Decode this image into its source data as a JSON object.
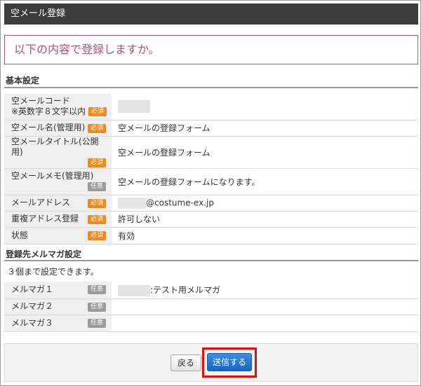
{
  "window_title": "空メール登録",
  "confirm_message": "以下の内容で登録しますか。",
  "basic": {
    "heading": "基本設定",
    "rows": [
      {
        "label": "空メールコード",
        "sub": "※英数字８文字以内",
        "badge": "必須",
        "value": ""
      },
      {
        "label": "空メール名(管理用)",
        "badge": "必須",
        "value": "空メールの登録フォーム"
      },
      {
        "label": "空メールタイトル(公開用)",
        "badge": "必須",
        "value": "空メールの登録フォーム"
      },
      {
        "label": "空メールメモ(管理用)",
        "badge": "任意",
        "value": "空メールの登録フォームになります。"
      },
      {
        "label": "メールアドレス",
        "badge": "必須",
        "value": "@costume-ex.jp"
      },
      {
        "label": "重複アドレス登録",
        "badge": "必須",
        "value": "許可しない"
      },
      {
        "label": "状態",
        "badge": "必須",
        "value": "有効"
      }
    ]
  },
  "magazine": {
    "heading": "登録先メルマガ設定",
    "note": "３個まで設定できます。",
    "rows": [
      {
        "label": "メルマガ１",
        "badge": "任意",
        "value": ":テスト用メルマガ"
      },
      {
        "label": "メルマガ２",
        "badge": "任意",
        "value": ""
      },
      {
        "label": "メルマガ３",
        "badge": "任意",
        "value": ""
      }
    ]
  },
  "buttons": {
    "back": "戻る",
    "submit": "送信する"
  },
  "colors": {
    "required_badge": "#f08a1c",
    "optional_badge": "#9b9b9b",
    "submit_button": "#1866c4",
    "highlight_outline": "#e01010",
    "confirm_text": "#b0507a"
  }
}
